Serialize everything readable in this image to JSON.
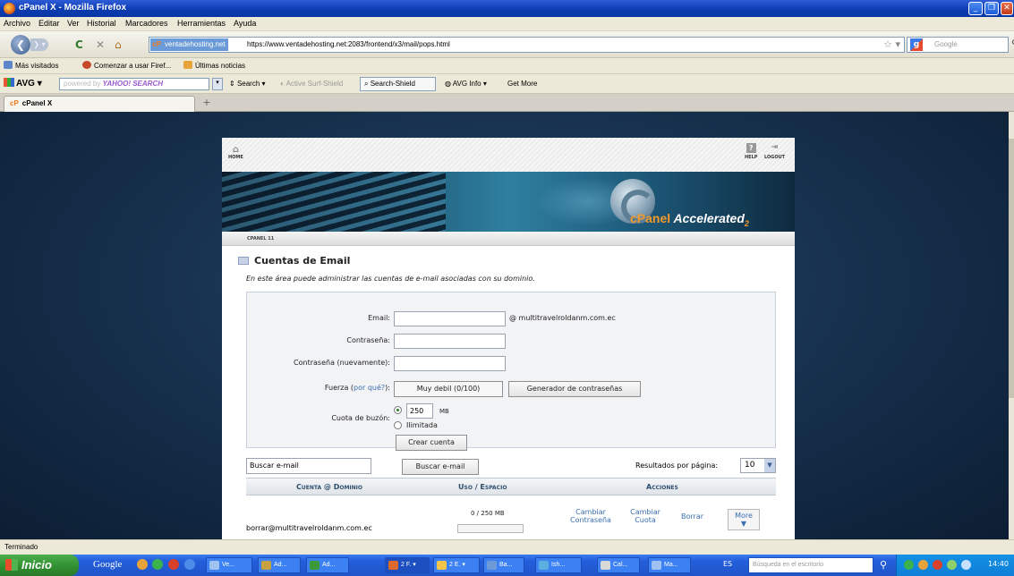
{
  "window": {
    "title": "cPanel X - Mozilla Firefox"
  },
  "menu": [
    "Archivo",
    "Editar",
    "Ver",
    "Historial",
    "Marcadores",
    "Herramientas",
    "Ayuda"
  ],
  "nav": {
    "site_badge": "ventadehosting.net",
    "url": "https://www.ventadehosting.net:2083/frontend/x3/mail/pops.html",
    "search_placeholder": "Google"
  },
  "bookmarks": [
    "Más visitados",
    "Comenzar a usar Firef...",
    "Últimas noticias"
  ],
  "avg": {
    "logo": "AVG",
    "search_hint": "powered by",
    "search_brand": "YAHOO! SEARCH",
    "items": [
      "Search",
      "Active Surf-Shield",
      "Search-Shield",
      "AVG Info",
      "Get More"
    ]
  },
  "tabs": [
    {
      "label": "cPanel X",
      "icon": "cP"
    }
  ],
  "cpanel": {
    "top": {
      "home": "HOME",
      "help": "HELP",
      "logout": "LOGOUT"
    },
    "brand": "cPanel",
    "brand_suffix": "Accelerated",
    "brand_sub": "2",
    "breadcrumb": "CPANEL 11",
    "section_title": "Cuentas de Email",
    "description": "En este área puede administrar las cuentas de e-mail asociadas con su dominio.",
    "form": {
      "email_label": "Email:",
      "email_value": "",
      "domain": "@ multitravelroldanm.com.ec",
      "password_label": "Contraseña:",
      "password_again_label": "Contraseña (nuevamente):",
      "strength_label": "Fuerza (",
      "strength_link": "por qué?",
      "strength_label_end": "):",
      "strength_value": "Muy debil (0/100)",
      "generator_button": "Generador de contraseñas",
      "quota_label": "Cuota de buzón:",
      "quota_value": "250",
      "quota_unit": "MB",
      "quota_unlimited": "Ilimitada",
      "create_button": "Crear cuenta"
    },
    "search": {
      "input_value": "Buscar e-mail",
      "button": "Buscar e-mail",
      "per_page_label": "Resultados por página:",
      "per_page_value": "10"
    },
    "table": {
      "headers": [
        "Cuenta @ Dominio",
        "Uso / Espacio",
        "Acciones"
      ],
      "rows": [
        {
          "account": "borrar@multitravelroldanm.com.ec",
          "usage": "0 / 250 MB",
          "usage_fraction": 0,
          "actions": [
            "Cambiar Contraseña",
            "Cambiar Cuota",
            "Borrar"
          ],
          "more": "More"
        }
      ]
    }
  },
  "status": "Terminado",
  "taskbar": {
    "start": "Inicio",
    "google": "Google",
    "buttons": [
      "Ve...",
      "Ad...",
      "Ad...",
      "2 F.",
      "2 E.",
      "Ba...",
      "Ish...",
      "Cal...",
      "Ma..."
    ],
    "lang": "ES",
    "search_placeholder": "Búsqueda en el escritorio",
    "time": "14:40"
  },
  "colors": {
    "titlebar": "#0a3ab0",
    "taskbar": "#245edb",
    "start": "#2f8d2f",
    "link": "#3a6fb0",
    "header_text": "#2f4f6f"
  }
}
